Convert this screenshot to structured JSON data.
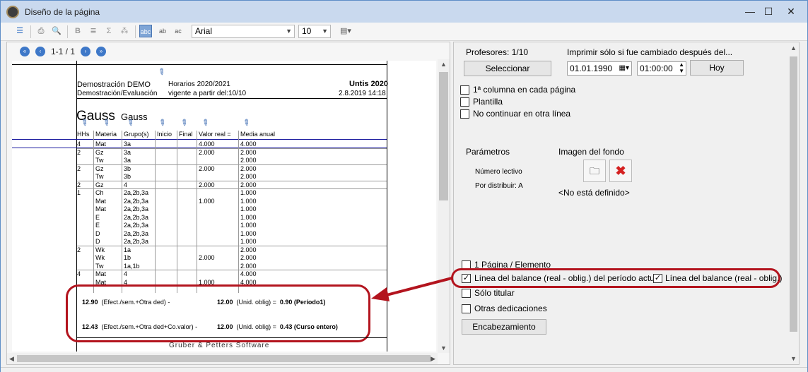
{
  "window": {
    "title": "Diseño de la página",
    "minimize": "—",
    "maximize": "☐",
    "close": "✕"
  },
  "toolbar": {
    "font": "Arial",
    "size": "10",
    "icon_names": [
      "list-icon",
      "print-icon",
      "print-preview-icon",
      "bold-icon",
      "align-icon",
      "sum-icon",
      "format-icon",
      "abc-icon",
      "abc-vertical-icon",
      "abc-rotated-icon",
      "paragraph-icon"
    ]
  },
  "nav": {
    "page": "1-1 / 1"
  },
  "report": {
    "school": "Demostración  DEMO",
    "schedule": "Horarios 2020/2021",
    "product": "Untis 2020",
    "school2": "Demostración/Evaluación",
    "valid": "vigente a partir del:10/10",
    "date": "2.8.2019  14:18",
    "teacher": "Gauss",
    "teacher_small": "Gauss",
    "headers": [
      "HHs",
      "Materia",
      "Grupo(s)",
      "Inicio",
      "Final",
      "Valor real =",
      "Media anual"
    ],
    "rows": [
      [
        "4",
        "Mat",
        "3a",
        "",
        "",
        "4.000",
        "4.000"
      ],
      [
        "2",
        "Gz",
        "3a",
        "",
        "",
        "2.000",
        "2.000"
      ],
      [
        "",
        "Tw",
        "3a",
        "",
        "",
        "",
        "2.000"
      ],
      [
        "2",
        "Gz",
        "3b",
        "",
        "",
        "2.000",
        "2.000"
      ],
      [
        "",
        "Tw",
        "3b",
        "",
        "",
        "",
        "2.000"
      ],
      [
        "2",
        "Gz",
        "4",
        "",
        "",
        "2.000",
        "2.000"
      ],
      [
        "1",
        "Ch",
        "2a,2b,3a",
        "",
        "",
        "",
        "1.000"
      ],
      [
        "",
        "Mat",
        "2a,2b,3a",
        "",
        "",
        "1.000",
        "1.000"
      ],
      [
        "",
        "Mat",
        "2a,2b,3a",
        "",
        "",
        "",
        "1.000"
      ],
      [
        "",
        "E",
        "2a,2b,3a",
        "",
        "",
        "",
        "1.000"
      ],
      [
        "",
        "E",
        "2a,2b,3a",
        "",
        "",
        "",
        "1.000"
      ],
      [
        "",
        "D",
        "2a,2b,3a",
        "",
        "",
        "",
        "1.000"
      ],
      [
        "",
        "D",
        "2a,2b,3a",
        "",
        "",
        "",
        "1.000"
      ],
      [
        "2",
        "Wk",
        "1a",
        "",
        "",
        "",
        "2.000"
      ],
      [
        "",
        "Wk",
        "1b",
        "",
        "",
        "2.000",
        "2.000"
      ],
      [
        "",
        "Tw",
        "1a,1b",
        "",
        "",
        "",
        "2.000"
      ],
      [
        "4",
        "Mat",
        "4",
        "",
        "",
        "",
        "4.000"
      ],
      [
        "",
        "Mat",
        "4",
        "",
        "",
        "1.000",
        "4.000"
      ]
    ],
    "bal1_val": "12.90",
    "bal1_txt": "(Efect./sem.+Otra ded) -",
    "bal1_oblig": "12.00",
    "bal1_unid": "(Unid. oblig) =",
    "bal1_res": "0.90 (Período1)",
    "bal2_val": "12.43",
    "bal2_txt": "(Efect./sem.+Otra ded+Co.valor) -",
    "bal2_oblig": "12.00",
    "bal2_unid": "(Unid. oblig) =",
    "bal2_res": "0.43 (Curso entero)",
    "footer": "Gruber & Petters Software"
  },
  "settings": {
    "teachers": "Profesores: 1/10",
    "print_changed": "Imprimir sólo si fue cambiado después del...",
    "select_btn": "Seleccionar",
    "date": "01.01.1990",
    "time": "01:00:00",
    "today_btn": "Hoy",
    "first_col": "1ª columna en cada página",
    "template": "Plantilla",
    "no_continue": "No continuar en otra línea",
    "params": "Parámetros",
    "bg_image": "Imagen del fondo",
    "param1": "Número lectivo",
    "param2": "Por distribuir: A",
    "not_defined": "<No está definido>",
    "one_page": "1 Página / Elemento",
    "balance_current": "Línea del balance (real - oblig.) del período actual",
    "balance": "Línea del balance (real - oblig.)",
    "only_title": "Sólo titular",
    "other_ded": "Otras dedicaciones",
    "header_btn": "Encabezamiento"
  },
  "colors": {
    "accent": "#b3141e",
    "selection": "#7fa5d6"
  }
}
